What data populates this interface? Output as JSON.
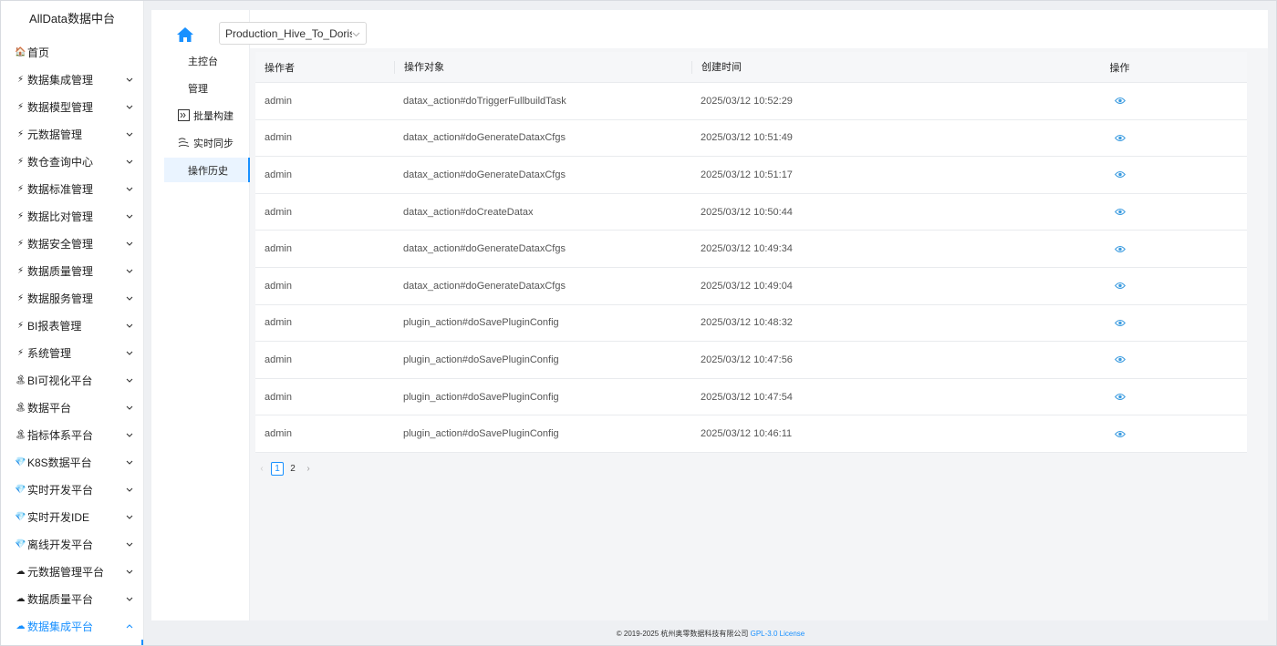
{
  "app": {
    "title": "AllData数据中台"
  },
  "sidebar": {
    "items": [
      {
        "icon": "🏠",
        "label": "首页",
        "chevron": ""
      },
      {
        "icon": "⚡",
        "label": "数据集成管理",
        "chevron": "down"
      },
      {
        "icon": "⚡",
        "label": "数据模型管理",
        "chevron": "down"
      },
      {
        "icon": "⚡",
        "label": "元数据管理",
        "chevron": "down"
      },
      {
        "icon": "⚡",
        "label": "数仓查询中心",
        "chevron": "down"
      },
      {
        "icon": "⚡",
        "label": "数据标准管理",
        "chevron": "down"
      },
      {
        "icon": "⚡",
        "label": "数据比对管理",
        "chevron": "down"
      },
      {
        "icon": "⚡",
        "label": "数据安全管理",
        "chevron": "down"
      },
      {
        "icon": "⚡",
        "label": "数据质量管理",
        "chevron": "down"
      },
      {
        "icon": "⚡",
        "label": "数据服务管理",
        "chevron": "down"
      },
      {
        "icon": "⚡",
        "label": "BI报表管理",
        "chevron": "down"
      },
      {
        "icon": "⚡",
        "label": "系统管理",
        "chevron": "down"
      },
      {
        "icon": "🏝",
        "label": "BI可视化平台",
        "chevron": "down"
      },
      {
        "icon": "🏝",
        "label": "数据平台",
        "chevron": "down"
      },
      {
        "icon": "🏝",
        "label": "指标体系平台",
        "chevron": "down"
      },
      {
        "icon": "💎",
        "label": "K8S数据平台",
        "chevron": "down"
      },
      {
        "icon": "💎",
        "label": "实时开发平台",
        "chevron": "down"
      },
      {
        "icon": "💎",
        "label": "实时开发IDE",
        "chevron": "down"
      },
      {
        "icon": "💎",
        "label": "离线开发平台",
        "chevron": "down"
      },
      {
        "icon": "☁",
        "label": "元数据管理平台",
        "chevron": "down"
      },
      {
        "icon": "☁",
        "label": "数据质量平台",
        "chevron": "down"
      },
      {
        "icon": "☁",
        "label": "数据集成平台",
        "chevron": "up",
        "active": true
      }
    ]
  },
  "pipeline": {
    "selected": "Production_Hive_To_Doris_..."
  },
  "subnav": {
    "items": [
      {
        "label": "主控台",
        "icon": ""
      },
      {
        "label": "管理",
        "icon": ""
      },
      {
        "label": "批量构建",
        "icon": "batch-build-icon"
      },
      {
        "label": "实时同步",
        "icon": "realtime-sync-icon"
      },
      {
        "label": "操作历史",
        "icon": "",
        "active": true
      }
    ]
  },
  "table": {
    "columns": [
      "操作者",
      "操作对象",
      "创建时间",
      "操作"
    ],
    "rows": [
      {
        "operator": "admin",
        "object": "datax_action#doTriggerFullbuildTask",
        "time": "2025/03/12 10:52:29"
      },
      {
        "operator": "admin",
        "object": "datax_action#doGenerateDataxCfgs",
        "time": "2025/03/12 10:51:49"
      },
      {
        "operator": "admin",
        "object": "datax_action#doGenerateDataxCfgs",
        "time": "2025/03/12 10:51:17"
      },
      {
        "operator": "admin",
        "object": "datax_action#doCreateDatax",
        "time": "2025/03/12 10:50:44"
      },
      {
        "operator": "admin",
        "object": "datax_action#doGenerateDataxCfgs",
        "time": "2025/03/12 10:49:34"
      },
      {
        "operator": "admin",
        "object": "datax_action#doGenerateDataxCfgs",
        "time": "2025/03/12 10:49:04"
      },
      {
        "operator": "admin",
        "object": "plugin_action#doSavePluginConfig",
        "time": "2025/03/12 10:48:32"
      },
      {
        "operator": "admin",
        "object": "plugin_action#doSavePluginConfig",
        "time": "2025/03/12 10:47:56"
      },
      {
        "operator": "admin",
        "object": "plugin_action#doSavePluginConfig",
        "time": "2025/03/12 10:47:54"
      },
      {
        "operator": "admin",
        "object": "plugin_action#doSavePluginConfig",
        "time": "2025/03/12 10:46:11"
      }
    ]
  },
  "pagination": {
    "prev": "‹",
    "pages": [
      "1",
      "2"
    ],
    "current": "1",
    "next": "›"
  },
  "footer": {
    "copyright": "© 2019-2025 杭州奥零数据科技有限公司",
    "license": "GPL-3.0 License"
  },
  "colors": {
    "accent": "#1890ff",
    "eye": "#3a9be0"
  }
}
